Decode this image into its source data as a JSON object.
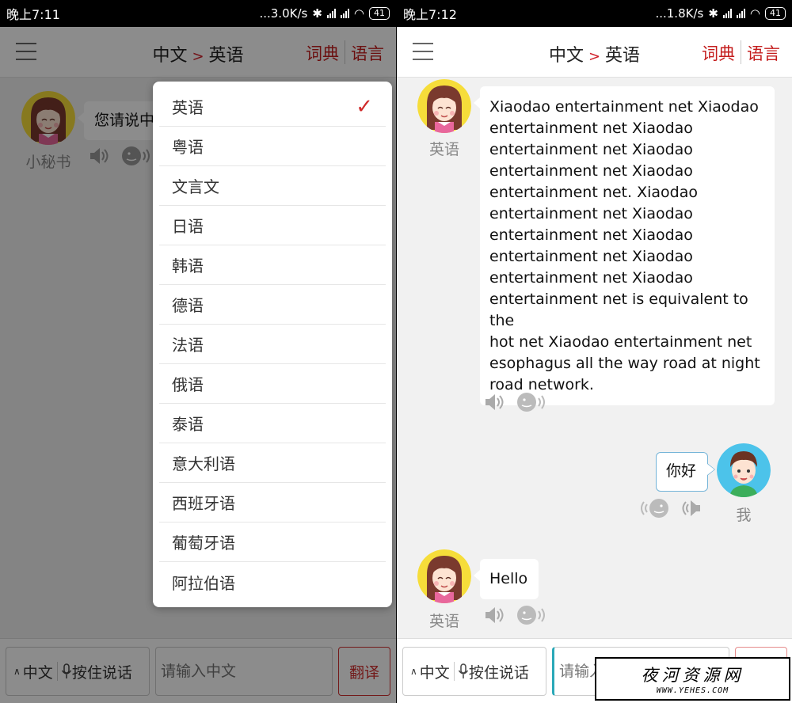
{
  "left": {
    "status": {
      "time": "晚上7:11",
      "speed": "...3.0K/s",
      "battery": "41"
    },
    "header": {
      "source_lang": "中文",
      "arrow": ">",
      "target_lang": "英语",
      "dict_btn": "词典",
      "lang_btn": "语言"
    },
    "assistant_name": "小秘书",
    "prompt": "您请说中",
    "dropdown": {
      "selected_mark": "✓",
      "items": [
        "英语",
        "粤语",
        "文言文",
        "日语",
        "韩语",
        "德语",
        "法语",
        "俄语",
        "泰语",
        "意大利语",
        "西班牙语",
        "葡萄牙语",
        "阿拉伯语"
      ]
    },
    "bottom": {
      "lang": "中文",
      "mic_label": "按住说话",
      "input_placeholder": "请输入中文",
      "translate": "翻译"
    }
  },
  "right": {
    "status": {
      "time": "晚上7:12",
      "speed": "...1.8K/s",
      "battery": "41"
    },
    "header": {
      "source_lang": "中文",
      "arrow": ">",
      "target_lang": "英语",
      "dict_btn": "词典",
      "lang_btn": "语言"
    },
    "msg1": {
      "sender": "英语",
      "lines": [
        "Xiaodao entertainment net Xiaodao",
        "entertainment net Xiaodao",
        "entertainment net Xiaodao",
        "entertainment net Xiaodao",
        "entertainment net. Xiaodao",
        "entertainment net Xiaodao",
        "entertainment net Xiaodao",
        "entertainment net Xiaodao",
        "entertainment net Xiaodao",
        "entertainment net is equivalent to the",
        "hot net Xiaodao entertainment net",
        "esophagus all the way road at night",
        "road network."
      ]
    },
    "msg2": {
      "sender": "我",
      "text": "你好"
    },
    "msg3": {
      "sender": "英语",
      "text": "Hello"
    },
    "bottom": {
      "lang": "中文",
      "mic_label": "按住说话",
      "input_placeholder": "请输入中文",
      "translate": "翻译"
    }
  },
  "watermark": {
    "title": "夜河资源网",
    "url": "WWW.YEHES.COM"
  }
}
